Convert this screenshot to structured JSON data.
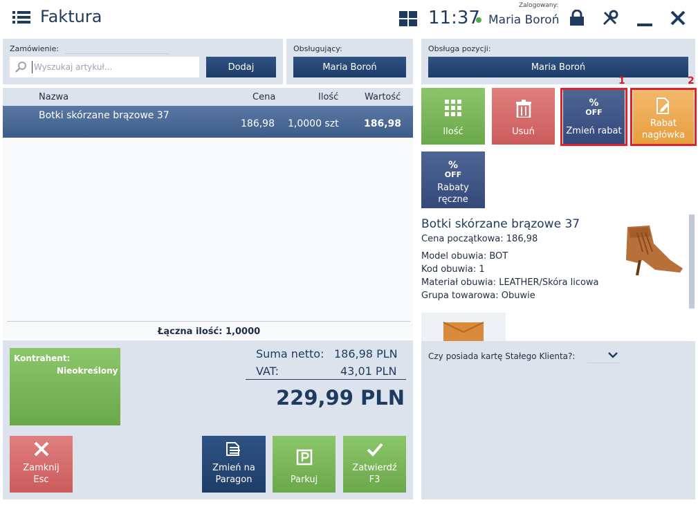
{
  "app": {
    "title": "Faktura",
    "time": "11:37",
    "logged_label": "Zalogowany:",
    "user": "Maria Boroń"
  },
  "order": {
    "label": "Zamówienie:",
    "search_placeholder": "Wyszukaj artykuł...",
    "add_label": "Dodaj"
  },
  "serving": {
    "label": "Obsługujący:",
    "value": "Maria Boroń"
  },
  "position_service": {
    "label": "Obsługa pozycji:",
    "value": "Maria Boroń"
  },
  "table": {
    "headers": {
      "name": "Nazwa",
      "price": "Cena",
      "qty": "Ilość",
      "value": "Wartość"
    },
    "rows": [
      {
        "name": "Botki skórzane brązowe 37",
        "price": "186,98",
        "qty": "1,0000 szt",
        "value": "186,98"
      }
    ],
    "total_qty_label": "Łączna ilość:",
    "total_qty_value": "1,0000"
  },
  "actions": {
    "qty": "Ilość",
    "delete": "Usuń",
    "change_discount": "Zmień rabat",
    "header_discount_1": "Rabat",
    "header_discount_2": "nagłówka",
    "manual_1": "Rabaty",
    "manual_2": "ręczne",
    "off_pct": "%",
    "off_text": "OFF"
  },
  "markers": {
    "first": "1",
    "second": "2"
  },
  "product": {
    "name": "Botki skórzane brązowe 37",
    "start_price": "Cena początkowa: 186,98",
    "model": "Model obuwia: BOT",
    "code": "Kod obuwia: 1",
    "material": "Materiał obuwia: LEATHER/Skóra licowa",
    "group": "Grupa towarowa: Obuwie"
  },
  "loyalty": {
    "question": "Czy posiada kartę Stałego Klienta?:"
  },
  "contractor": {
    "label": "Kontrahent:",
    "value": "Nieokreślony"
  },
  "summary": {
    "net_label": "Suma netto:",
    "net_value": "186,98 PLN",
    "vat_label": "VAT:",
    "vat_value": "43,01 PLN",
    "total": "229,99 PLN"
  },
  "bottom": {
    "close_1": "Zamknij",
    "close_2": "Esc",
    "receipt_1": "Zmień na",
    "receipt_2": "Paragon",
    "park": "Parkuj",
    "confirm_1": "Zatwierdź",
    "confirm_2": "F3"
  },
  "colors": {
    "accent_blue": "#1e3c68",
    "green": "#6aa84a",
    "red": "#cc5b5b",
    "navy": "#34497a",
    "orange": "#e89e3e",
    "status_online": "#4caf50"
  }
}
